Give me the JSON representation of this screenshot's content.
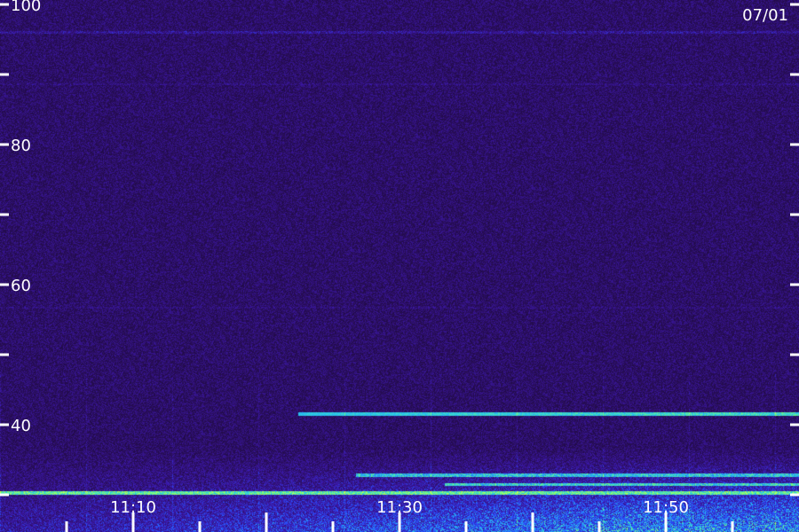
{
  "chart_data": {
    "type": "heatmap",
    "date_label": "07/01",
    "y_ticks": [
      "100",
      "80",
      "60",
      "40"
    ],
    "x_ticks": [
      "11:10",
      "11:30",
      "11:50"
    ],
    "yrange": [
      30,
      100
    ],
    "xrange_minutes": [
      11.0,
      11.0
    ],
    "colors": {
      "background": "#2a0e5c",
      "low": "#3a18a8",
      "mid": "#1f6cff",
      "high": "#31e0e8",
      "peak": "#c8ff3a"
    }
  }
}
